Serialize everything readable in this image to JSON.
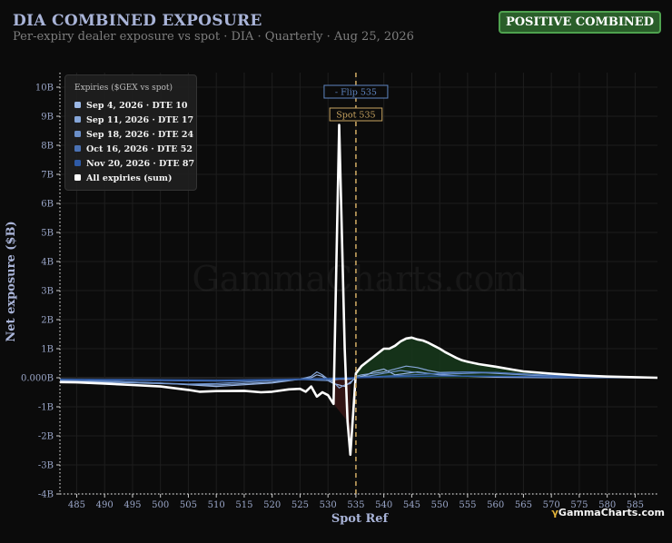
{
  "header": {
    "title": "DIA COMBINED EXPOSURE",
    "subtitle": "Per-expiry dealer exposure vs spot · DIA · Quarterly · Aug 25, 2026",
    "badge": "POSITIVE COMBINED"
  },
  "footer": {
    "logo_symbol": "γ",
    "logo_text": "GammaCharts.com"
  },
  "watermark": "GammaCharts.com",
  "colors": {
    "background": "#0b0b0b",
    "sum_line": "#ffffff",
    "flip_marker": "#5f86c2",
    "spot_marker": "#c8a460",
    "positive_fill": "#173a1c",
    "negative_fill": "#3a1616",
    "badge_bg": "#2a5e2a"
  },
  "chart_data": {
    "type": "line",
    "xlabel": "Spot Ref",
    "ylabel": "Net exposure ($B)",
    "xlim": [
      482,
      589
    ],
    "ylim": [
      -4,
      10.5
    ],
    "x_ticks": [
      485,
      490,
      495,
      500,
      505,
      510,
      515,
      520,
      525,
      530,
      535,
      540,
      545,
      550,
      555,
      560,
      565,
      570,
      575,
      580,
      585
    ],
    "y_ticks": [
      -4,
      -3,
      -2,
      -1,
      0,
      1,
      2,
      3,
      4,
      5,
      6,
      7,
      8,
      9,
      10
    ],
    "y_tick_labels": [
      "-4B",
      "-3B",
      "-2B",
      "-1B",
      "0.000B",
      "1B",
      "2B",
      "3B",
      "4B",
      "5B",
      "6B",
      "7B",
      "8B",
      "9B",
      "10B"
    ],
    "grid": true,
    "legend_title": "Expiries ($GEX vs spot)",
    "legend_position": "top-left",
    "flip": {
      "x": 535,
      "label": "- Flip 535"
    },
    "spot": {
      "x": 535,
      "label": "Spot 535"
    },
    "series": [
      {
        "name": "Sep 4, 2026 · DTE 10",
        "color": "#9cb8e6",
        "width": 1.2,
        "x": [
          482,
          490,
          500,
          510,
          520,
          525,
          527,
          528,
          529,
          530,
          531,
          532,
          533,
          534,
          535,
          536,
          537,
          538,
          539,
          540,
          541,
          542,
          544,
          546,
          548,
          550,
          555,
          560,
          570,
          589
        ],
        "y": [
          -0.1,
          -0.12,
          -0.18,
          -0.3,
          -0.18,
          -0.05,
          0.0,
          0.1,
          0.05,
          -0.1,
          -0.2,
          -0.25,
          -0.3,
          -0.15,
          0.0,
          0.05,
          0.1,
          0.2,
          0.25,
          0.3,
          0.2,
          0.1,
          0.15,
          0.2,
          0.15,
          0.1,
          0.05,
          0.02,
          0.0,
          0.0
        ]
      },
      {
        "name": "Sep 11, 2026 · DTE 17",
        "color": "#86a6d8",
        "width": 1.2,
        "x": [
          482,
          490,
          500,
          510,
          520,
          525,
          527,
          528,
          529,
          530,
          531,
          532,
          533,
          534,
          535,
          536,
          538,
          540,
          542,
          544,
          546,
          548,
          550,
          555,
          560,
          565,
          570,
          589
        ],
        "y": [
          -0.12,
          -0.15,
          -0.2,
          -0.25,
          -0.15,
          -0.05,
          0.05,
          0.2,
          0.1,
          -0.05,
          -0.15,
          -0.35,
          -0.25,
          -0.2,
          0.05,
          0.1,
          0.15,
          0.2,
          0.3,
          0.4,
          0.35,
          0.25,
          0.18,
          0.2,
          0.15,
          0.1,
          0.05,
          0.0
        ]
      },
      {
        "name": "Sep 18, 2026 · DTE 24",
        "color": "#6b8fc8",
        "width": 1.2,
        "x": [
          482,
          490,
          500,
          505,
          510,
          520,
          525,
          528,
          530,
          532,
          534,
          535,
          537,
          540,
          543,
          545,
          548,
          550,
          555,
          560,
          570,
          589
        ],
        "y": [
          -0.1,
          -0.12,
          -0.18,
          -0.22,
          -0.2,
          -0.1,
          -0.05,
          -0.08,
          -0.1,
          -0.05,
          -0.05,
          0.0,
          0.05,
          0.15,
          0.25,
          0.2,
          0.15,
          0.12,
          0.15,
          0.18,
          0.08,
          0.0
        ]
      },
      {
        "name": "Oct 16, 2026 · DTE 52",
        "color": "#4b72b4",
        "width": 1.2,
        "x": [
          482,
          490,
          500,
          510,
          520,
          530,
          535,
          540,
          545,
          550,
          555,
          560,
          565,
          570,
          580,
          589
        ],
        "y": [
          -0.06,
          -0.08,
          -0.1,
          -0.12,
          -0.08,
          -0.05,
          0.0,
          0.05,
          0.1,
          0.15,
          0.2,
          0.18,
          0.12,
          0.08,
          0.03,
          0.0
        ]
      },
      {
        "name": "Nov 20, 2026 · DTE 87",
        "color": "#2e5aa6",
        "width": 1.4,
        "x": [
          482,
          490,
          500,
          510,
          520,
          530,
          535,
          540,
          550,
          560,
          570,
          580,
          589
        ],
        "y": [
          -0.05,
          -0.06,
          -0.07,
          -0.08,
          -0.06,
          -0.03,
          0.0,
          0.03,
          0.06,
          0.05,
          0.03,
          0.01,
          0.0
        ]
      },
      {
        "name": "All expiries (sum)",
        "color": "#ffffff",
        "width": 2.6,
        "x": [
          482,
          485,
          490,
          495,
          500,
          505,
          507,
          510,
          515,
          518,
          520,
          523,
          525,
          526,
          527,
          528,
          529,
          530,
          531,
          532,
          533,
          533.5,
          534,
          535,
          536,
          537,
          538,
          539,
          540,
          541,
          542,
          543,
          544,
          545,
          546,
          547,
          548,
          549,
          550,
          551,
          552,
          553,
          554,
          555,
          557,
          560,
          563,
          565,
          570,
          575,
          580,
          585,
          589
        ],
        "y": [
          -0.15,
          -0.16,
          -0.2,
          -0.25,
          -0.3,
          -0.42,
          -0.48,
          -0.46,
          -0.45,
          -0.5,
          -0.48,
          -0.4,
          -0.38,
          -0.48,
          -0.3,
          -0.65,
          -0.5,
          -0.6,
          -0.9,
          8.7,
          1.0,
          -1.5,
          -2.65,
          0.15,
          0.4,
          0.55,
          0.7,
          0.85,
          1.0,
          1.0,
          1.1,
          1.25,
          1.35,
          1.38,
          1.32,
          1.28,
          1.2,
          1.1,
          1.0,
          0.88,
          0.78,
          0.68,
          0.6,
          0.55,
          0.47,
          0.38,
          0.28,
          0.22,
          0.14,
          0.08,
          0.04,
          0.02,
          0.0
        ]
      }
    ]
  }
}
